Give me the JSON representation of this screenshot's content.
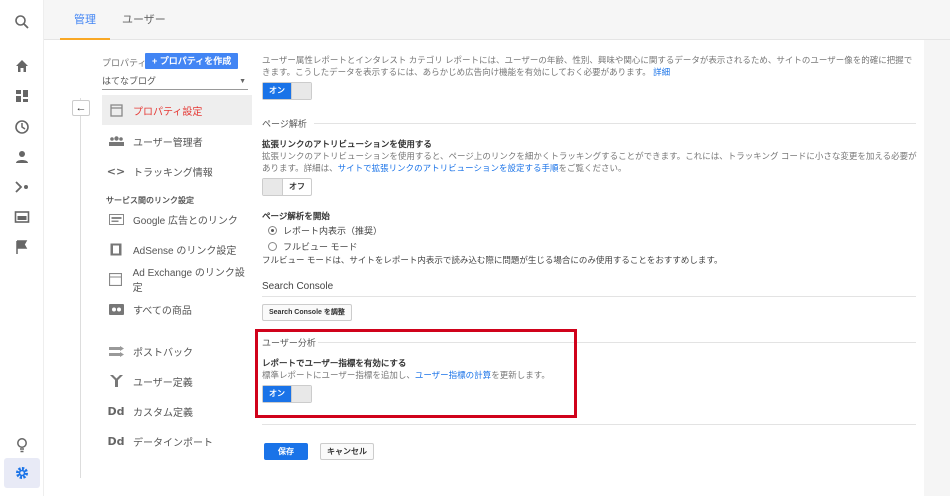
{
  "rail": {
    "icons": [
      "search-icon",
      "home-icon",
      "dashboard-icon",
      "clock-icon",
      "person-icon",
      "acquisition-icon",
      "behavior-icon",
      "flag-icon",
      "lightbulb-icon",
      "gear-icon"
    ]
  },
  "tabs": [
    {
      "label": "管理",
      "active": true
    },
    {
      "label": "ユーザー",
      "active": false
    }
  ],
  "property": {
    "label": "プロパティ",
    "create_button": "+ プロパティを作成",
    "selected": "はてなブログ"
  },
  "nav": {
    "items": [
      {
        "label": "プロパティ設定",
        "icon": "property-settings-icon"
      },
      {
        "label": "ユーザー管理者",
        "icon": "users-icon"
      },
      {
        "label": "トラッキング情報",
        "icon": "code-icon"
      }
    ],
    "section_label": "サービス間のリンク設定",
    "link_items": [
      {
        "label": "Google 広告とのリンク",
        "icon": "ads-icon"
      },
      {
        "label": "AdSense のリンク設定",
        "icon": "adsense-icon"
      },
      {
        "label": "Ad Exchange のリンク設定",
        "icon": "adexchange-icon"
      },
      {
        "label": "すべての商品",
        "icon": "products-icon"
      },
      {
        "label": "ポストバック",
        "icon": "postback-icon"
      },
      {
        "label": "ユーザー定義",
        "icon": "filter-icon"
      },
      {
        "label": "カスタム定義",
        "icon": "dd-icon"
      },
      {
        "label": "データインポート",
        "icon": "dd-icon"
      }
    ]
  },
  "content": {
    "demographics_text": "ユーザー属性レポートとインタレスト カテゴリ レポートには、ユーザーの年齢、性別、興味や関心に関するデータが表示されるため、サイトのユーザー像を的確に把握できます。こうしたデータを表示するには、あらかじめ広告向け機能を有効にしておく必要があります。",
    "demographics_link": "詳細",
    "toggle_on_label": "オン",
    "toggle_off_label": "オフ",
    "page_analytics_title": "ページ解析",
    "enhanced_link_title": "拡張リンクのアトリビューションを使用する",
    "enhanced_link_text": "拡張リンクのアトリビューションを使用すると、ページ上のリンクを細かくトラッキングすることができます。これには、トラッキング コードに小さな変更を加える必要があります。詳細は、",
    "enhanced_link_link": "サイトで拡張リンクのアトリビューションを設定する手順",
    "enhanced_link_suffix": "をご覧ください。",
    "page_analytics_start_title": "ページ解析を開始",
    "radio_report": "レポート内表示（推奨）",
    "radio_full": "フルビュー モード",
    "full_view_note": "フルビュー モードは、サイトをレポート内表示で読み込む際に問題が生じる場合にのみ使用することをおすすめします。",
    "search_console_title": "Search Console",
    "search_console_button": "Search Console を調整",
    "user_analysis_title": "ユーザー分析",
    "user_metrics_title": "レポートでユーザー指標を有効にする",
    "user_metrics_text": "標準レポートにユーザー指標を追加し、",
    "user_metrics_link": "ユーザー指標の計算",
    "user_metrics_suffix": "を更新します。",
    "save_button": "保存",
    "cancel_button": "キャンセル"
  },
  "colors": {
    "accent": "#1a73e8",
    "active_nav": "#e53935",
    "highlight": "#d0021b",
    "tab_underline": "#f9a825"
  }
}
